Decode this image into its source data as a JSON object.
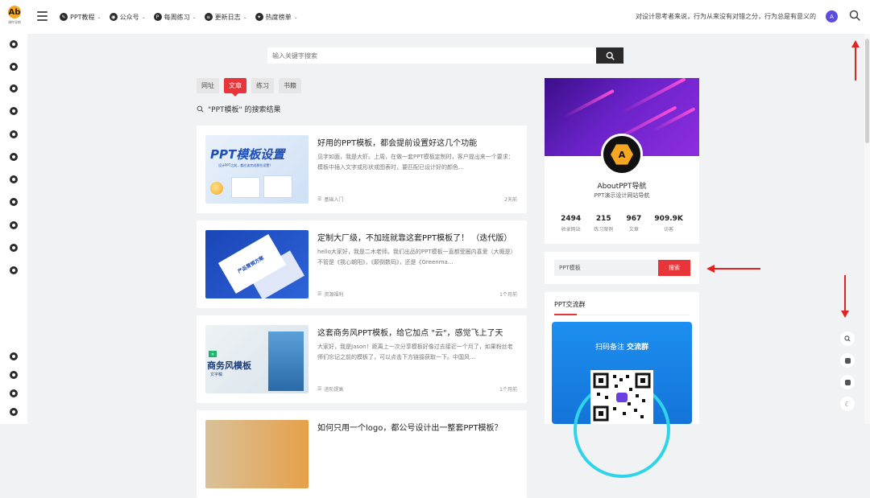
{
  "header": {
    "logo_text": "Ab",
    "logo_caption": "课件导航",
    "nav": [
      {
        "label": "PPT教程",
        "icon": "pencil-icon"
      },
      {
        "label": "公众号",
        "icon": "wechat-icon"
      },
      {
        "label": "每周练习",
        "icon": "p-icon"
      },
      {
        "label": "更新日志",
        "icon": "log-icon"
      },
      {
        "label": "热度榜单",
        "icon": "fire-icon"
      }
    ],
    "slogan": "对设计思考者来说，行为从来没有对错之分，行为总是有意义的",
    "badge": "A"
  },
  "search": {
    "placeholder": "输入关键字搜索"
  },
  "tabs": [
    "网址",
    "文章",
    "练习",
    "书籍"
  ],
  "active_tab": "文章",
  "result_title": "\"PPT模板\" 的搜索结果",
  "articles": [
    {
      "title": "好用的PPT模板，都会提前设置好这几个功能",
      "excerpt": "见字如面，我是大虾。上周，在做一套PPT模板定制时，客户提出来一个要求：模板中插入文字或形状或图表时，要匹配已设计好的颜色...",
      "category": "基础入门",
      "time": "2天前",
      "thumb_title": "PPT模板设置",
      "thumb_sub": "设计PPT之前，都应该完成那些设置？"
    },
    {
      "title": "定制大厂级，不加班就靠这套PPT模板了！ （迭代版）",
      "excerpt": "hello大家好，我是二木老师。我们出品的PPT模板一直都受圈内喜爱（大概是）不管是《我心朝阳》，《颠倒数码》，还是《Greenma...",
      "category": "资源福利",
      "time": "1个月前",
      "thumb_title": "产品营销方案"
    },
    {
      "title": "这套商务风PPT模板，给它加点 \"云\"，感觉飞上了天",
      "excerpt": "大家好，我是Jason！距离上一次分享模板好像过去接近一个月了，如果粉丝老师们忘记之前的模板了，可以点击下方链接获取一下。中国风...",
      "category": "进阶提高",
      "time": "1个月前",
      "thumb_tag": "云",
      "thumb_title": "商务风模板",
      "thumb_sub": "文字稿"
    },
    {
      "title": "如何只用一个logo，都公号设计出一整套PPT模板？",
      "excerpt": "",
      "category": "",
      "time": ""
    }
  ],
  "profile": {
    "avatar_text": "A",
    "name": "AboutPPT导航",
    "desc": "PPT演示设计网站导航",
    "stats": [
      {
        "value": "2494",
        "label": "收录网站"
      },
      {
        "value": "215",
        "label": "练习案例"
      },
      {
        "value": "967",
        "label": "文章"
      },
      {
        "value": "909.9K",
        "label": "访客"
      }
    ]
  },
  "widget_search": {
    "value": "PPT模板",
    "button": "搜索"
  },
  "group": {
    "title": "PPT交流群",
    "scan_text": "扫码备注",
    "scan_bold": "交流群"
  },
  "float_tools": [
    "search-icon",
    "tag-icon",
    "calendar-icon",
    "moon-icon"
  ],
  "colors": {
    "accent": "#e8353a",
    "brand": "#f5a623",
    "arrow": "#e32222"
  }
}
